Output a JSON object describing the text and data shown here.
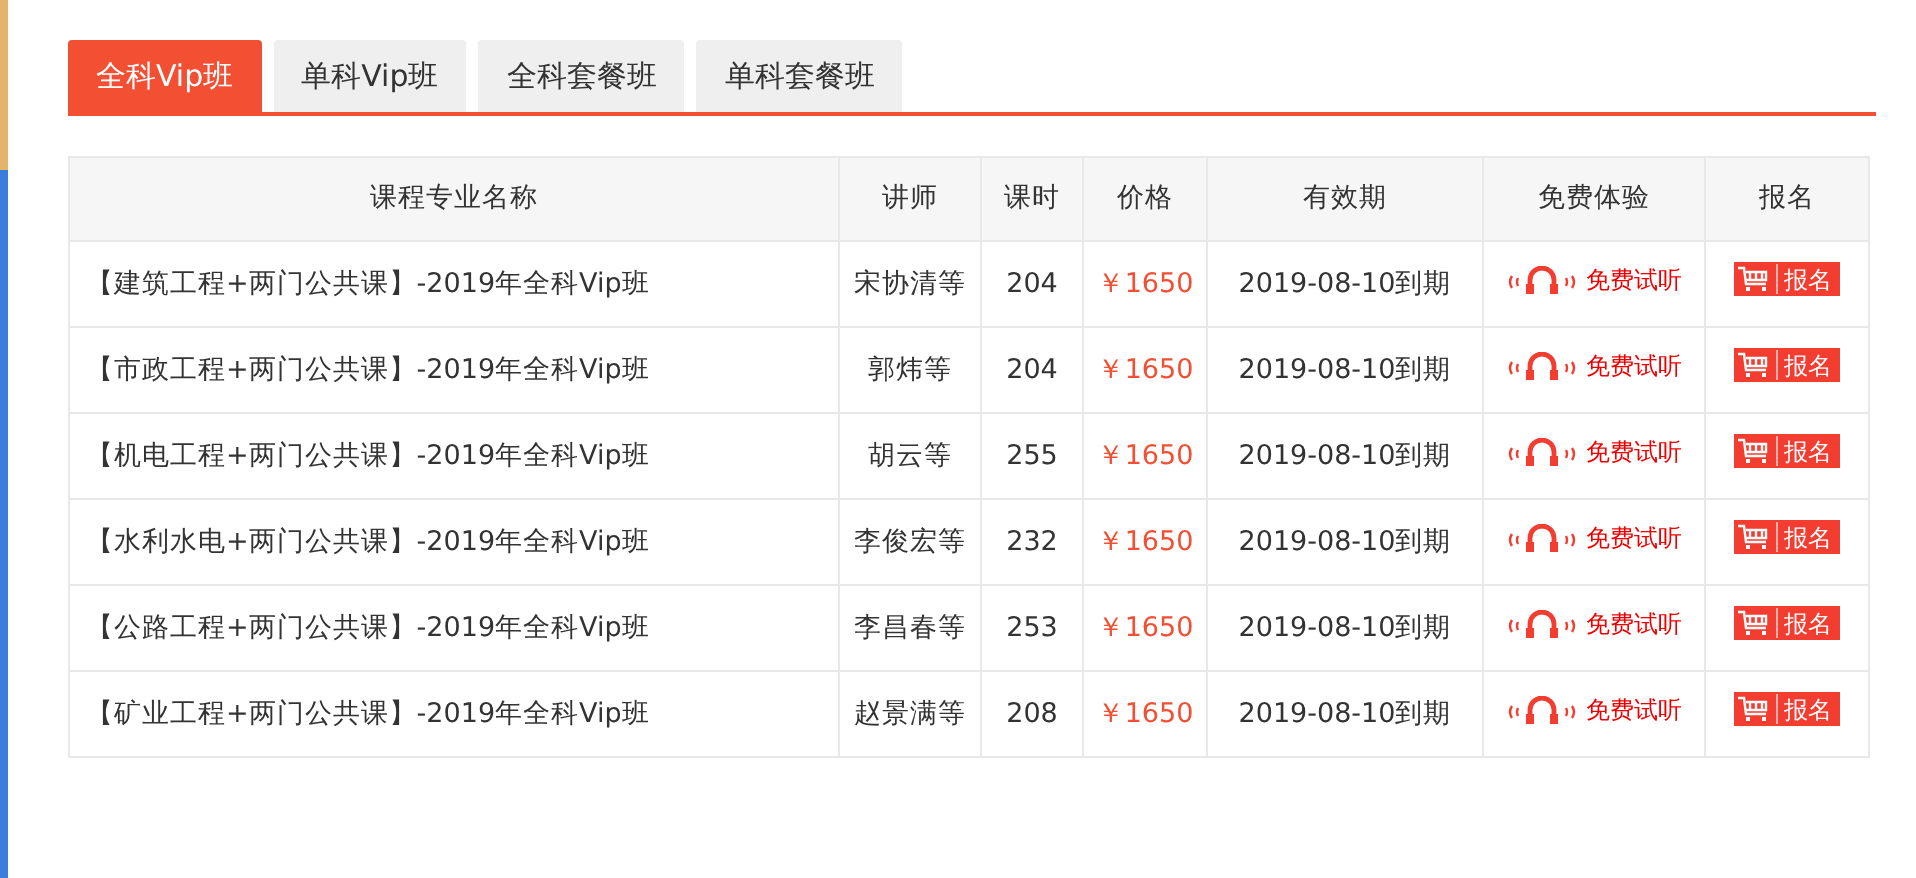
{
  "tabs": [
    {
      "label": "全科Vip班",
      "selected": true
    },
    {
      "label": "单科Vip班",
      "selected": false
    },
    {
      "label": "全科套餐班",
      "selected": false
    },
    {
      "label": "单科套餐班",
      "selected": false
    }
  ],
  "table": {
    "columns": [
      "课程专业名称",
      "讲师",
      "课时",
      "价格",
      "有效期",
      "免费体验",
      "报名"
    ],
    "rows": [
      {
        "name": "【建筑工程+两门公共课】-2019年全科Vip班",
        "teacher": "宋协清等",
        "hours": "204",
        "price": "￥1650",
        "validity": "2019-08-10到期",
        "trial": "免费试听",
        "signup": "报名"
      },
      {
        "name": "【市政工程+两门公共课】-2019年全科Vip班",
        "teacher": "郭炜等",
        "hours": "204",
        "price": "￥1650",
        "validity": "2019-08-10到期",
        "trial": "免费试听",
        "signup": "报名"
      },
      {
        "name": "【机电工程+两门公共课】-2019年全科Vip班",
        "teacher": "胡云等",
        "hours": "255",
        "price": "￥1650",
        "validity": "2019-08-10到期",
        "trial": "免费试听",
        "signup": "报名"
      },
      {
        "name": "【水利水电+两门公共课】-2019年全科Vip班",
        "teacher": "李俊宏等",
        "hours": "232",
        "price": "￥1650",
        "validity": "2019-08-10到期",
        "trial": "免费试听",
        "signup": "报名"
      },
      {
        "name": "【公路工程+两门公共课】-2019年全科Vip班",
        "teacher": "李昌春等",
        "hours": "253",
        "price": "￥1650",
        "validity": "2019-08-10到期",
        "trial": "免费试听",
        "signup": "报名"
      },
      {
        "name": "【矿业工程+两门公共课】-2019年全科Vip班",
        "teacher": "赵景满等",
        "hours": "208",
        "price": "￥1650",
        "validity": "2019-08-10到期",
        "trial": "免费试听",
        "signup": "报名"
      }
    ]
  }
}
